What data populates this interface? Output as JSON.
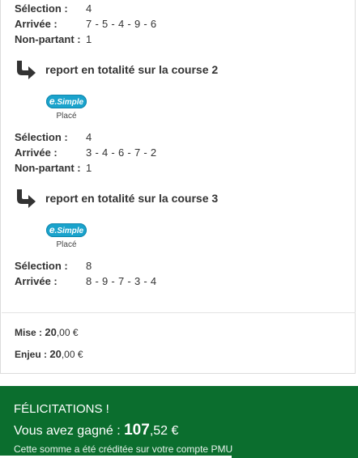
{
  "labels": {
    "selection": "Sélection :",
    "arrivee": "Arrivée :",
    "non_partant": "Non-partant :"
  },
  "block1": {
    "selection": "4",
    "arrivee": "7 - 5 - 4 - 9 - 6",
    "non_partant": "1"
  },
  "report1": {
    "text": "report en totalité sur la course 2",
    "bet_logo": "e.Simple",
    "bet_type": "Placé"
  },
  "block2": {
    "selection": "4",
    "arrivee": "3 - 4 - 6 - 7 - 2",
    "non_partant": "1"
  },
  "report2": {
    "text": "report en totalité sur la course 3",
    "bet_logo": "e.Simple",
    "bet_type": "Placé"
  },
  "block3": {
    "selection": "8",
    "arrivee": "8 - 9 - 7 - 3 - 4"
  },
  "summary": {
    "mise_label": "Mise :",
    "mise_int": "20",
    "mise_dec": ",00 €",
    "enjeu_label": "Enjeu :",
    "enjeu_int": "20",
    "enjeu_dec": ",00 €"
  },
  "banner": {
    "title": "FÉLICITATIONS !",
    "won_prefix": "Vous avez gagné :",
    "amount_int": "107",
    "amount_dec": ",52 €",
    "note": "Cette somme a été créditée sur votre compte PMU"
  },
  "colors": {
    "banner_bg": "#0b6e2e",
    "badge": "#1aa3cc",
    "arrow": "#333333"
  },
  "icons": {
    "report": "curved-arrow-right-icon"
  }
}
